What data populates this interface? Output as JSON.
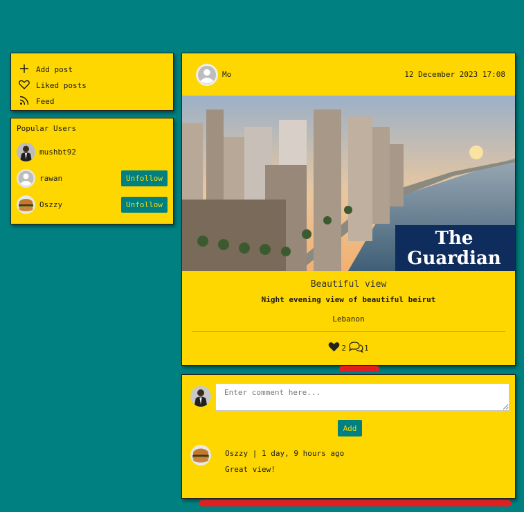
{
  "menu": {
    "items": [
      {
        "label": "Add post",
        "icon": "plus-icon"
      },
      {
        "label": "Liked posts",
        "icon": "heart-icon"
      },
      {
        "label": "Feed",
        "icon": "rss-icon"
      }
    ]
  },
  "popular": {
    "title": "Popular Users",
    "users": [
      {
        "name": "mushbt92",
        "button": ""
      },
      {
        "name": "rawan",
        "button": "Unfollow"
      },
      {
        "name": "Oszzy",
        "button": "Unfollow"
      }
    ]
  },
  "post": {
    "author": "Mo",
    "date": "12 December 2023 17:08",
    "image_brand": [
      "The",
      "Guardian"
    ],
    "title": "Beautiful view",
    "description": "Night evening view of beautiful beirut",
    "location": "Lebanon",
    "likes": "2",
    "comments": "1"
  },
  "comment_form": {
    "placeholder": "Enter comment here...",
    "add_label": "Add"
  },
  "comments": [
    {
      "author": "Oszzy",
      "separator": "|",
      "time": "1 day, 9 hours ago",
      "text": "Great view!"
    }
  ],
  "colors": {
    "background": "#008080",
    "card": "#ffd700",
    "button": "#008080",
    "accent_bar": "#e02020"
  }
}
